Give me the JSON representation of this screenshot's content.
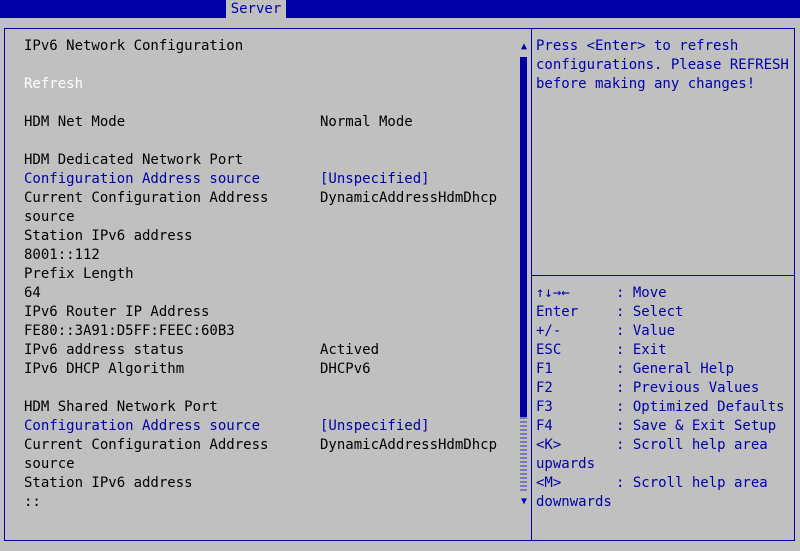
{
  "header": {
    "tab": "Server"
  },
  "main": {
    "title": "IPv6 Network Configuration",
    "refresh": "Refresh",
    "net_mode_label": "HDM Net Mode",
    "net_mode_value": "Normal Mode",
    "dedicated": {
      "heading": "HDM Dedicated Network Port",
      "config_src_label": "Configuration Address source",
      "config_src_value": "[Unspecified]",
      "current_src_label_1": "Current Configuration Address",
      "current_src_label_2": "source",
      "current_src_value": "DynamicAddressHdmDhcp",
      "station_label": "Station IPv6 address",
      "station_value": "8001::112",
      "prefix_label": "Prefix Length",
      "prefix_value": "64",
      "router_label": "IPv6 Router IP Address",
      "router_value": "FE80::3A91:D5FF:FEEC:60B3",
      "status_label": "IPv6 address status",
      "status_value": "Actived",
      "dhcp_label": "IPv6 DHCP Algorithm",
      "dhcp_value": "DHCPv6"
    },
    "shared": {
      "heading": "HDM Shared Network Port",
      "config_src_label": "Configuration Address source",
      "config_src_value": "[Unspecified]",
      "current_src_label_1": "Current Configuration Address",
      "current_src_label_2": "source",
      "current_src_value": "DynamicAddressHdmDhcp",
      "station_label": "Station IPv6 address",
      "station_value": "::"
    }
  },
  "help": {
    "lines": [
      "Press <Enter> to refresh",
      "configurations. Please REFRESH",
      "before making any changes!"
    ]
  },
  "keys": [
    {
      "key": "↑↓→←",
      "action": ": Move"
    },
    {
      "key": "Enter",
      "action": ": Select"
    },
    {
      "key": "+/-",
      "action": ": Value"
    },
    {
      "key": "ESC",
      "action": ": Exit"
    },
    {
      "key": "F1",
      "action": ": General Help"
    },
    {
      "key": "F2",
      "action": ": Previous Values"
    },
    {
      "key": "F3",
      "action": ": Optimized Defaults"
    },
    {
      "key": "F4",
      "action": ": Save & Exit Setup"
    },
    {
      "key": "<K>",
      "action": ": Scroll help area",
      "cont": "upwards"
    },
    {
      "key": "<M>",
      "action": ": Scroll help area",
      "cont": "downwards"
    }
  ],
  "scroll": {
    "up_icon": "▲",
    "down_icon": "▼"
  },
  "colors": {
    "background": "#c0c0c0",
    "accent": "#0000a8",
    "highlight": "#ffffff"
  }
}
